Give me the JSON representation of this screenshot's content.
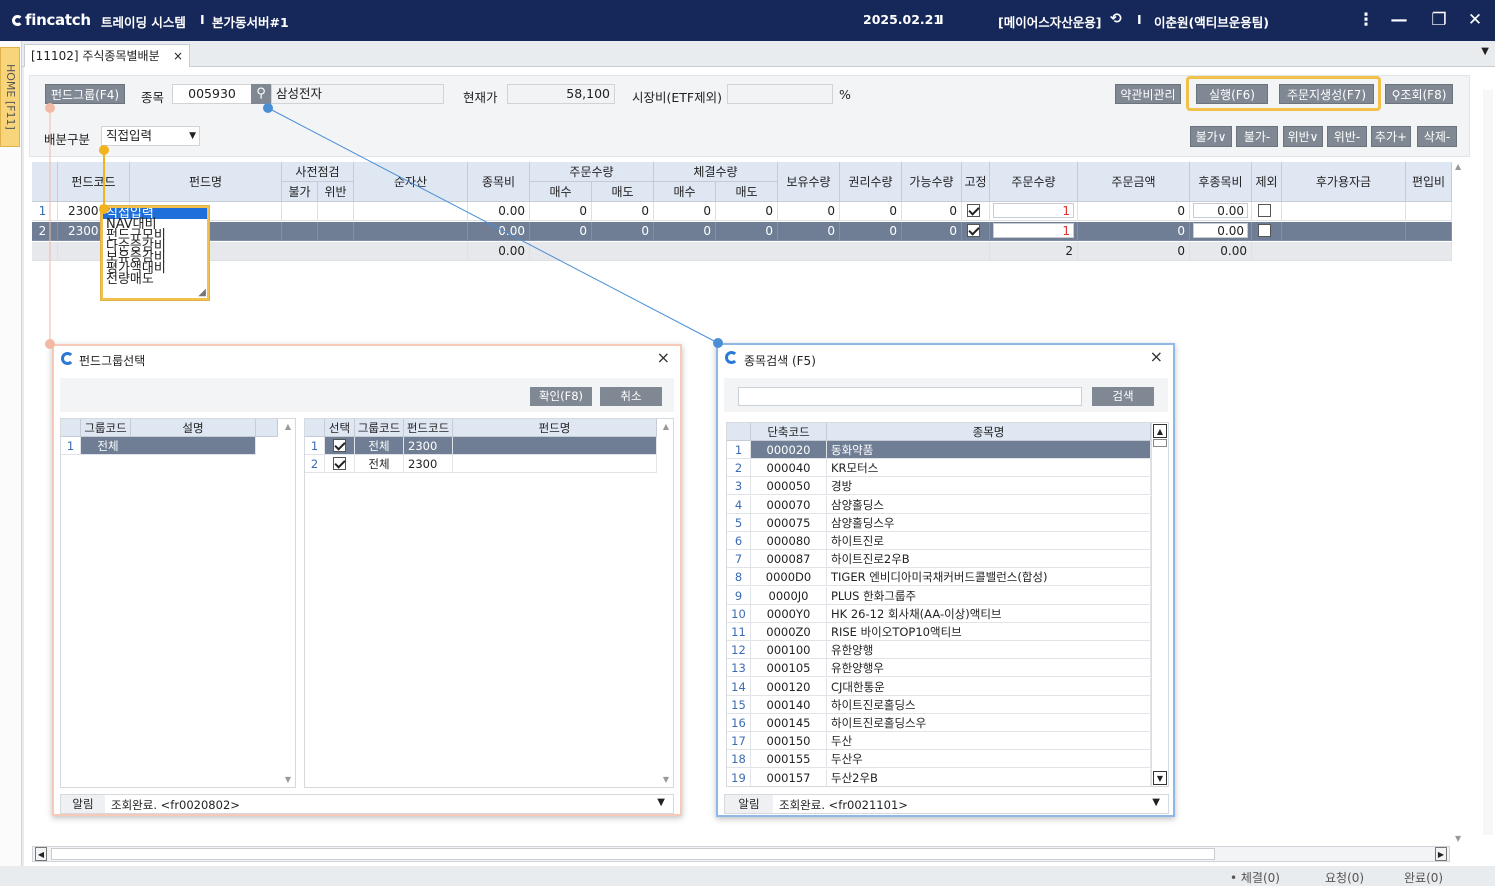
{
  "titlebar": {
    "brand": "fincatch",
    "system": "트레이딩 시스템",
    "server": "본가동서버#1",
    "date": "2025.02.21",
    "org": "[메이어스자산운용]",
    "user": "이춘원(액티브운용팀)",
    "sep": "I",
    "colors": {
      "bg": "#16285a"
    }
  },
  "sidebar": {
    "home_label": "HOME [F11]"
  },
  "tab": {
    "label": "[11102] 주식종목별배분",
    "close": "×"
  },
  "toolbar": {
    "fund_group_btn": "펀드그룹(F4)",
    "stock_label": "종목",
    "stock_code": "005930",
    "stock_name": "삼성전자",
    "price_label": "현재가",
    "price_value": "58,100",
    "ratio_label": "시장비(ETF제외)",
    "ratio_value": "",
    "percent": "%",
    "policy_btn": "약관비관리",
    "run_btn": "실행(F6)",
    "order_btn": "주문지생성(F7)",
    "query_btn": "조회(F8)",
    "alloc_label": "배분구분",
    "alloc_value": "직접입력",
    "small_btns": [
      "불가∨",
      "불가-",
      "위반∨",
      "위반-",
      "추가+",
      "삭제-"
    ]
  },
  "alloc_dropdown": {
    "options": [
      "직접입력",
      "NAV대비",
      "펀드규모비",
      "다순증감비",
      "보유증감비",
      "평가액대비",
      "전량매도"
    ]
  },
  "grid": {
    "headers": {
      "fund_code": "펀드코드",
      "fund_name": "펀드명",
      "precheck": "사전점검",
      "no": "불가",
      "viol": "위반",
      "nav": "순자산",
      "weight": "종목비",
      "order_qty_grp": "주문수량",
      "buy": "매수",
      "sell": "매도",
      "exec_qty_grp": "체결수량",
      "hold": "보유수량",
      "right": "권리수량",
      "avail": "가능수량",
      "fixed": "고정",
      "order_qty": "주문수량",
      "order_amt": "주문금액",
      "after_weight": "후종목비",
      "exclude": "제외",
      "after_cash": "후가용자금",
      "incl": "편입비"
    },
    "rows": [
      {
        "no": "1",
        "code": "2300",
        "name": "",
        "weight": "0.00",
        "b1": "0",
        "s1": "0",
        "b2": "0",
        "s2": "0",
        "hold": "0",
        "right": "0",
        "avail": "0",
        "order_qty": "1",
        "order_amt": "0",
        "after_weight": "0.00"
      },
      {
        "no": "2",
        "code": "2300",
        "name": "",
        "weight": "0.00",
        "b1": "0",
        "s1": "0",
        "b2": "0",
        "s2": "0",
        "hold": "0",
        "right": "0",
        "avail": "0",
        "order_qty": "1",
        "order_amt": "0",
        "after_weight": "0.00"
      }
    ],
    "total": {
      "weight": "0.00",
      "order_qty": "2",
      "order_amt": "0",
      "after_weight": "0.00"
    }
  },
  "fund_dialog": {
    "title": "펀드그룹선택",
    "ok_btn": "확인(F8)",
    "cancel_btn": "취소",
    "left_headers": [
      "그룹코드",
      "설명"
    ],
    "left_rows": [
      {
        "no": "1",
        "code": "전체"
      }
    ],
    "right_headers": [
      "선택",
      "그룹코드",
      "펀드코드",
      "펀드명"
    ],
    "right_rows": [
      {
        "no": "1",
        "group": "전체",
        "code": "2300"
      },
      {
        "no": "2",
        "group": "전체",
        "code": "2300"
      }
    ],
    "status_label": "알림",
    "status_text": "조회완료. <fr0020802>"
  },
  "stock_dialog": {
    "title": "종목검색 (F5)",
    "search_btn": "검색",
    "headers": [
      "단축코드",
      "종목명"
    ],
    "rows": [
      {
        "no": "1",
        "code": "000020",
        "name": "동화약품"
      },
      {
        "no": "2",
        "code": "000040",
        "name": "KR모터스"
      },
      {
        "no": "3",
        "code": "000050",
        "name": "경방"
      },
      {
        "no": "4",
        "code": "000070",
        "name": "삼양홀딩스"
      },
      {
        "no": "5",
        "code": "000075",
        "name": "삼양홀딩스우"
      },
      {
        "no": "6",
        "code": "000080",
        "name": "하이트진로"
      },
      {
        "no": "7",
        "code": "000087",
        "name": "하이트진로2우B"
      },
      {
        "no": "8",
        "code": "0000D0",
        "name": "TIGER 엔비디아미국채커버드콜밸런스(합성)"
      },
      {
        "no": "9",
        "code": "0000J0",
        "name": "PLUS 한화그룹주"
      },
      {
        "no": "10",
        "code": "0000Y0",
        "name": "HK 26-12 회사채(AA-이상)액티브"
      },
      {
        "no": "11",
        "code": "0000Z0",
        "name": "RISE 바이오TOP10액티브"
      },
      {
        "no": "12",
        "code": "000100",
        "name": "유한양행"
      },
      {
        "no": "13",
        "code": "000105",
        "name": "유한양행우"
      },
      {
        "no": "14",
        "code": "000120",
        "name": "CJ대한통운"
      },
      {
        "no": "15",
        "code": "000140",
        "name": "하이트진로홀딩스"
      },
      {
        "no": "16",
        "code": "000145",
        "name": "하이트진로홀딩스우"
      },
      {
        "no": "17",
        "code": "000150",
        "name": "두산"
      },
      {
        "no": "18",
        "code": "000155",
        "name": "두산우"
      },
      {
        "no": "19",
        "code": "000157",
        "name": "두산2우B"
      }
    ],
    "status_label": "알림",
    "status_text": "조회완료. <fr0021101>"
  },
  "statusbar": {
    "exec": "• 체결(0)",
    "req": "요청(0)",
    "done": "완료(0)"
  }
}
